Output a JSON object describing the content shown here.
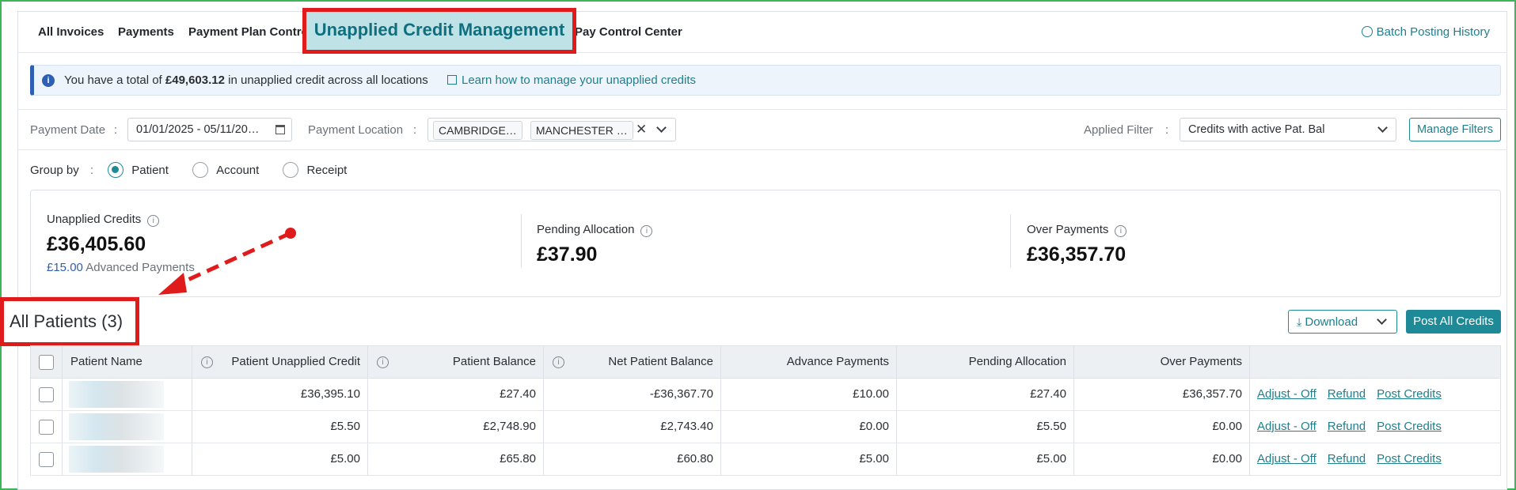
{
  "tabs": {
    "items": [
      "All Invoices",
      "Payments",
      "Payment Plan Contro",
      "Unapplied Credit Management",
      "Pay Control Center"
    ],
    "batch_label": "Batch Posting History"
  },
  "banner": {
    "prefix": "You have a total of ",
    "amount": "£49,603.12",
    "suffix": " in unapplied credit across all locations",
    "link": "Learn how to manage your unapplied credits"
  },
  "filters": {
    "payment_date_label": "Payment Date",
    "payment_date_value": "01/01/2025 - 05/11/20…",
    "payment_location_label": "Payment Location",
    "location_chips": [
      "CAMBRIDGE…",
      "MANCHESTER …"
    ],
    "applied_filter_label": "Applied Filter",
    "applied_filter_value": "Credits with active Pat. Bal",
    "manage_filters": "Manage Filters",
    "separator": ":"
  },
  "group_by": {
    "label": "Group by",
    "options": [
      "Patient",
      "Account",
      "Receipt"
    ],
    "selected": "Patient"
  },
  "summary": {
    "unapplied_label": "Unapplied Credits",
    "unapplied_value": "£36,405.60",
    "advanced_amount": "£15.00",
    "advanced_label": "Advanced Payments",
    "pending_label": "Pending Allocation",
    "pending_value": "£37.90",
    "over_label": "Over Payments",
    "over_value": "£36,357.70"
  },
  "section": {
    "title": "All Patients (3)",
    "download": "Download",
    "post_all": "Post All Credits"
  },
  "table": {
    "headers": [
      "Patient Name",
      "Patient Unapplied Credit",
      "Patient Balance",
      "Net Patient Balance",
      "Advance Payments",
      "Pending Allocation",
      "Over Payments"
    ],
    "rows": [
      {
        "unapplied": "£36,395.10",
        "balance": "£27.40",
        "net": "-£36,367.70",
        "advance": "£10.00",
        "pending": "£27.40",
        "over": "£36,357.70"
      },
      {
        "unapplied": "£5.50",
        "balance": "£2,748.90",
        "net": "£2,743.40",
        "advance": "£0.00",
        "pending": "£5.50",
        "over": "£0.00"
      },
      {
        "unapplied": "£5.00",
        "balance": "£65.80",
        "net": "£60.80",
        "advance": "£5.00",
        "pending": "£5.00",
        "over": "£0.00"
      }
    ],
    "actions": [
      "Adjust - Off",
      "Refund",
      "Post Credits"
    ]
  },
  "colors": {
    "accent": "#1f8a97",
    "annotation": "#e01b1b",
    "active_tab_bg": "#bfe2e6"
  }
}
